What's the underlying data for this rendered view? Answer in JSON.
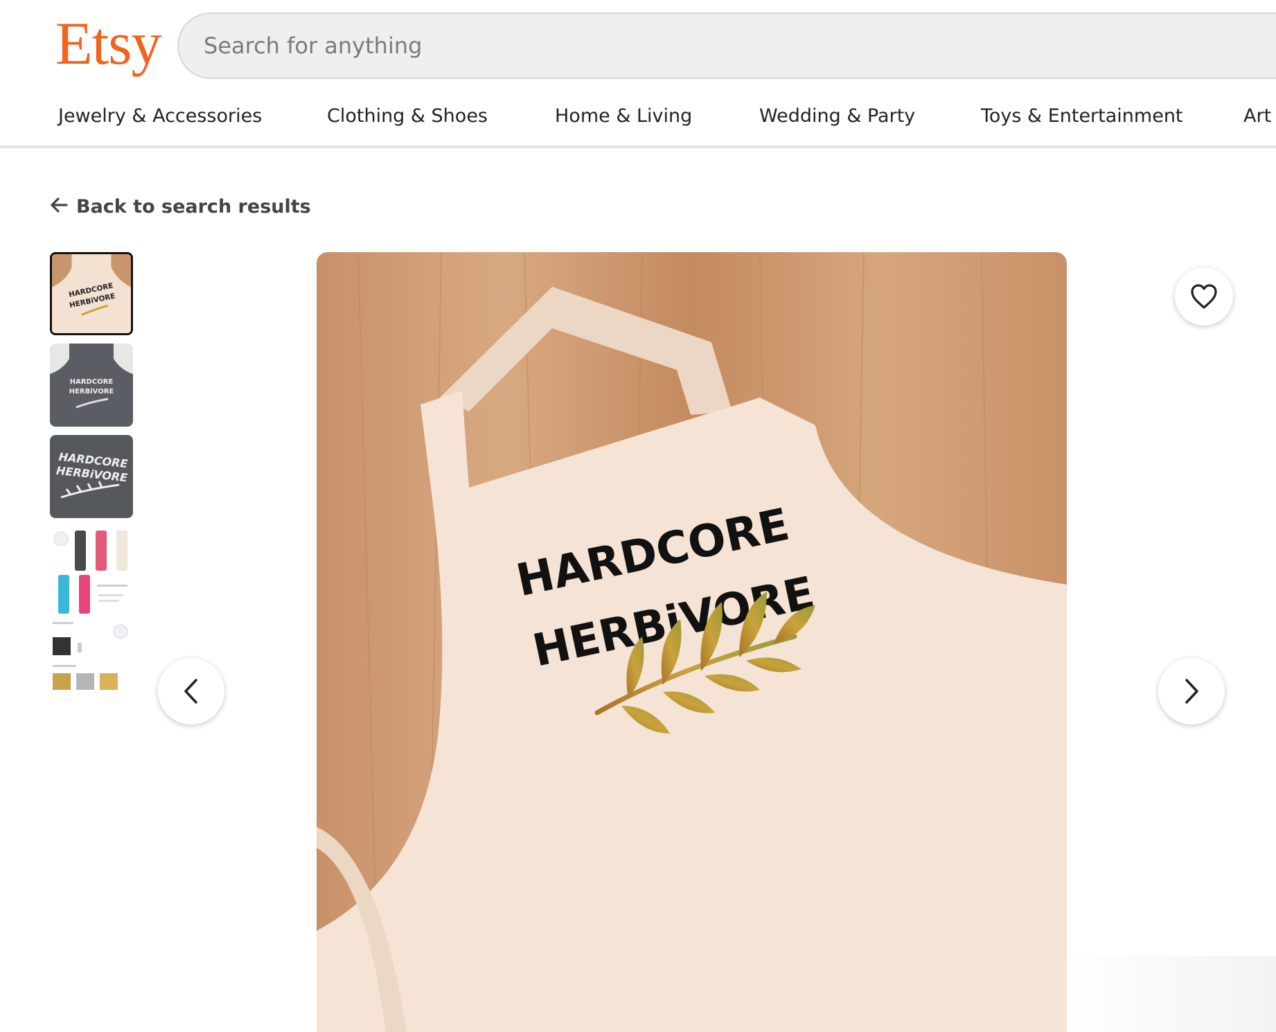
{
  "header": {
    "logo": "Etsy",
    "search_placeholder": "Search for anything"
  },
  "categories": [
    "Jewelry & Accessories",
    "Clothing & Shoes",
    "Home & Living",
    "Wedding & Party",
    "Toys & Entertainment",
    "Art &"
  ],
  "back_link": "Back to search results",
  "thumbnails": [
    {
      "selected": true,
      "colors": [
        "#f3e1d2"
      ]
    },
    {
      "selected": false,
      "colors": [
        "#5a5d63"
      ]
    },
    {
      "selected": false,
      "colors": [
        "#55585d"
      ]
    },
    {
      "selected": false,
      "colors": [
        "#4a4a4a",
        "#e25a77",
        "#efe6dc",
        "#3ab7d8",
        "#e8457c"
      ]
    },
    {
      "selected": false,
      "colors": [
        "#333333",
        "#c9a24b",
        "#b5b5b5"
      ]
    }
  ],
  "main_image": {
    "line1": "HARDCORE",
    "line2": "HERBiVORE",
    "apron_color": "#f5e3d5",
    "wood_color": "#c9956b",
    "leaf_color": "#c9a23a"
  },
  "icons": {
    "favorite": "heart-icon",
    "previous": "chevron-left-icon",
    "next": "chevron-right-icon",
    "back": "arrow-left-icon"
  },
  "brand_color": "#f1641e"
}
